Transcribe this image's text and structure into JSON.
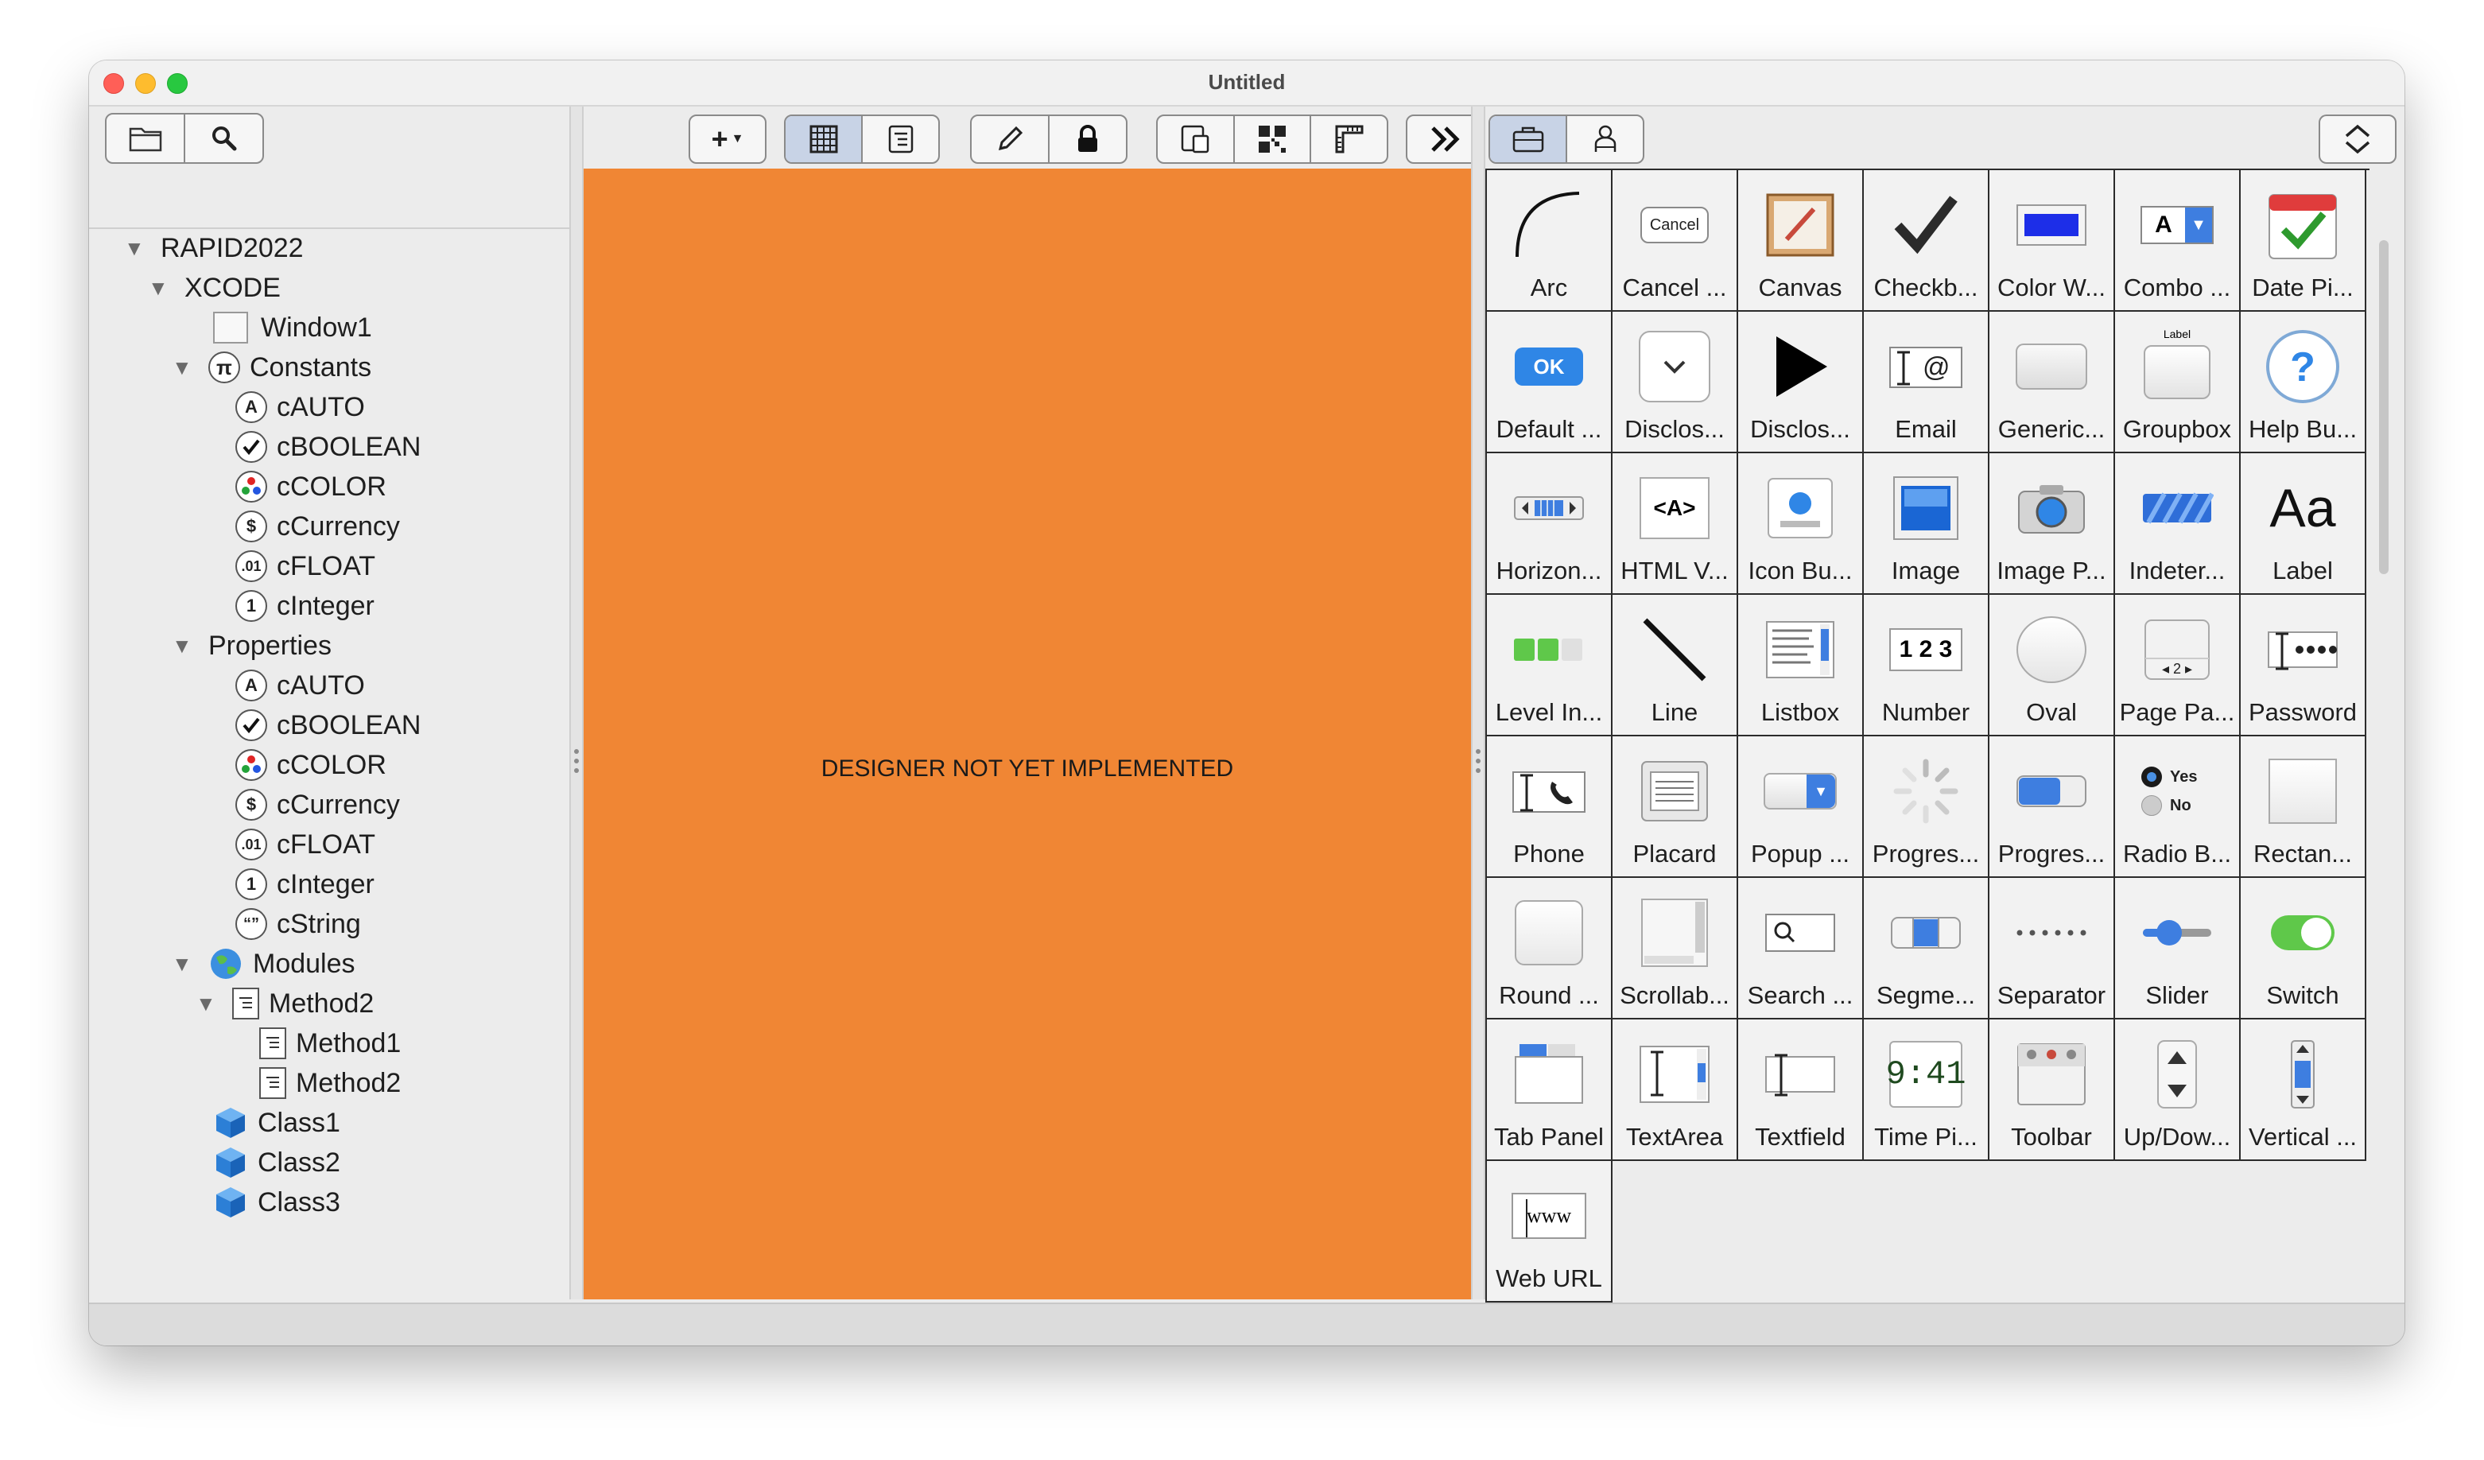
{
  "window": {
    "title": "Untitled"
  },
  "left_toolbar": {
    "folder_icon": "folder-icon",
    "search_icon": "search-icon"
  },
  "tree": {
    "root": "RAPID2022",
    "project": "XCODE",
    "window1": "Window1",
    "constants": {
      "label": "Constants",
      "items": [
        "cAUTO",
        "cBOOLEAN",
        "cCOLOR",
        "cCurrency",
        "cFLOAT",
        "cInteger"
      ]
    },
    "properties": {
      "label": "Properties",
      "items": [
        "cAUTO",
        "cBOOLEAN",
        "cCOLOR",
        "cCurrency",
        "cFLOAT",
        "cInteger",
        "cString"
      ]
    },
    "modules": {
      "label": "Modules",
      "method_parent": "Method2",
      "methods": [
        "Method1",
        "Method2"
      ]
    },
    "classes": [
      "Class1",
      "Class2",
      "Class3"
    ],
    "type_badges": {
      "auto": "A",
      "currency": "$",
      "float": ".01",
      "integer": "1",
      "string": "“”"
    }
  },
  "designer": {
    "message": "DESIGNER NOT YET IMPLEMENTED",
    "background": "#f08634"
  },
  "center_toolbar": {
    "add_label": "+",
    "icons": [
      "add-menu-icon",
      "grid-view-icon",
      "code-view-icon",
      "pencil-icon",
      "lock-icon",
      "window-icon",
      "qr-icon",
      "ruler-icon",
      "chevron-right-double-icon"
    ]
  },
  "palette": {
    "items": [
      "Arc",
      "Cancel ...",
      "Canvas",
      "Checkb...",
      "Color W...",
      "Combo ...",
      "Date Pi...",
      "Default ...",
      "Disclos...",
      "Disclos...",
      "Email",
      "Generic...",
      "Groupbox",
      "Help Bu...",
      "Horizon...",
      "HTML V...",
      "Icon Bu...",
      "Image",
      "Image P...",
      "Indeter...",
      "Label",
      "Level In...",
      "Line",
      "Listbox",
      "Number",
      "Oval",
      "Page Pa...",
      "Password",
      "Phone",
      "Placard",
      "Popup ...",
      "Progres...",
      "Progres...",
      "Radio B...",
      "Rectan...",
      "Round ...",
      "Scrollab...",
      "Search ...",
      "Segme...",
      "Separator",
      "Slider",
      "Switch",
      "Tab Panel",
      "TextArea",
      "Textfield",
      "Time Pi...",
      "Toolbar",
      "Up/Dow...",
      "Vertical ...",
      "Web URL"
    ],
    "icon_text": {
      "cancel": "Cancel",
      "ok": "OK",
      "html": "<A>",
      "number": "1 2 3",
      "label": "Aa",
      "time": "9:41",
      "www": "www",
      "radio_yes": "Yes",
      "radio_no": "No",
      "combo_a": "A",
      "groupbox": "Label"
    }
  }
}
